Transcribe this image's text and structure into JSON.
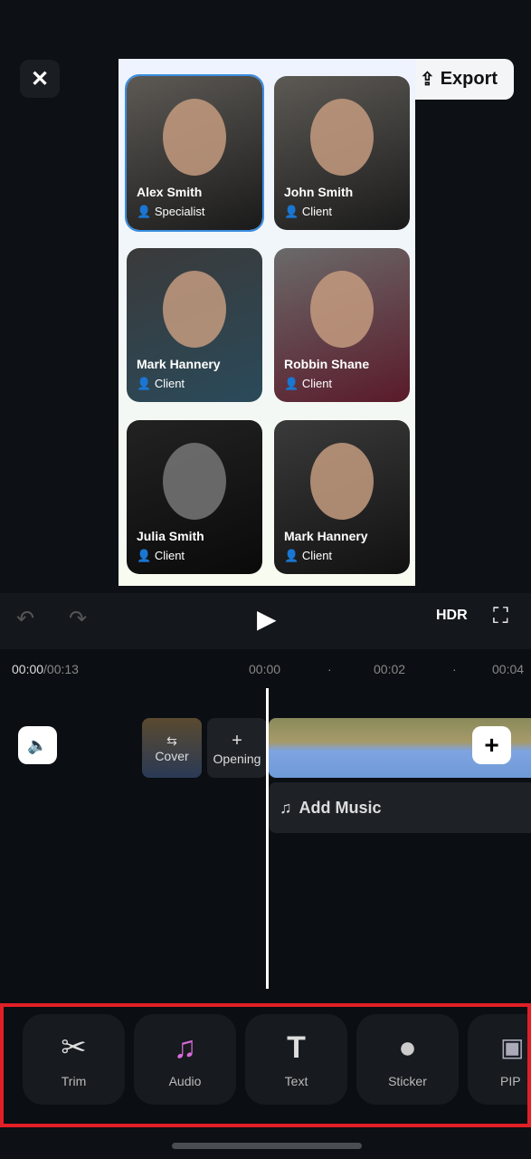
{
  "header": {
    "close_icon": "close-icon",
    "export_label": "Export"
  },
  "preview": {
    "cards": [
      {
        "name": "Alex Smith",
        "role": "Specialist"
      },
      {
        "name": "John Smith",
        "role": "Client"
      },
      {
        "name": "Mark Hannery",
        "role": "Client"
      },
      {
        "name": "Robbin Shane",
        "role": "Client"
      },
      {
        "name": "Julia Smith",
        "role": "Client"
      },
      {
        "name": "Mark Hannery",
        "role": "Client"
      }
    ]
  },
  "timeline": {
    "current": "00:00",
    "total": "/00:13",
    "ticks": [
      "00:00",
      "00:02",
      "00:04"
    ],
    "cover_label": "Cover",
    "opening_label": "Opening",
    "add_music_label": "Add Music"
  },
  "tools": [
    {
      "label": "Trim",
      "icon": "scissors-icon"
    },
    {
      "label": "Audio",
      "icon": "music-note-icon"
    },
    {
      "label": "Text",
      "icon": "text-icon"
    },
    {
      "label": "Sticker",
      "icon": "sticker-icon"
    },
    {
      "label": "PIP",
      "icon": "image-icon"
    }
  ],
  "colors": {
    "highlight": "#e21f26",
    "selected": "#3a8de0"
  }
}
